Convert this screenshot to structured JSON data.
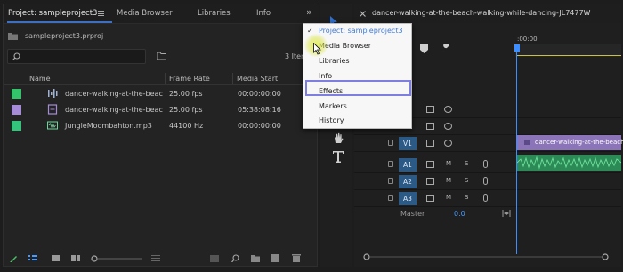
{
  "project_panel": {
    "tabs": [
      {
        "label": "Project: sampleproject3"
      },
      {
        "label": "Media Browser"
      },
      {
        "label": "Libraries"
      },
      {
        "label": "Info"
      }
    ],
    "more_tabs_glyph": "»",
    "folder_label": "sampleproject3.prproj",
    "search_placeholder": "",
    "items_count": "3 Item",
    "columns": {
      "name": "Name",
      "frame_rate": "Frame Rate",
      "media_start": "Media Start"
    },
    "rows": [
      {
        "name": "dancer-walking-at-the-beac",
        "frame_rate": "25.00 fps",
        "media_start": "00:00:00:00",
        "swatch_color": "#33c36a",
        "icon": "sequence-icon"
      },
      {
        "name": "dancer-walking-at-the-beac",
        "frame_rate": "25.00 fps",
        "media_start": "05:38:08:16",
        "swatch_color": "#a58bd8",
        "icon": "video-clip-icon"
      },
      {
        "name": "JungleMoombahton.mp3",
        "frame_rate": "44100 Hz",
        "media_start": "00:00:00:00",
        "swatch_color": "#33c37a",
        "icon": "audio-clip-icon"
      }
    ]
  },
  "timeline": {
    "sequence_title": "dancer-walking-at-the-beach-walking-while-dancing-JL7477W",
    "timecode_fragment": "00",
    "ruler_time": ":00:00",
    "tracks": [
      {
        "label": "V1"
      },
      {
        "label": "A1",
        "mute": "M",
        "solo": "S"
      },
      {
        "label": "A2",
        "mute": "M",
        "solo": "S"
      },
      {
        "label": "A3",
        "mute": "M",
        "solo": "S"
      }
    ],
    "video_clip_label": "dancer-walking-at-the-beach-w",
    "master_label": "Master",
    "master_value": "0.0"
  },
  "window_menu": {
    "items": [
      {
        "label": "Project: sampleproject3",
        "checked": true
      },
      {
        "label": "Media Browser"
      },
      {
        "label": "Libraries"
      },
      {
        "label": "Info"
      },
      {
        "label": "Effects",
        "highlighted": true
      },
      {
        "label": "Markers"
      },
      {
        "label": "History"
      }
    ],
    "check_glyph": "✓"
  },
  "colors": {
    "accent_blue": "#4a9bff",
    "track_label_bg": "#2b5a87",
    "video_clip": "#8b74b8",
    "audio_clip": "#2b8a55",
    "menu_highlight_border": "#7d7ee0"
  }
}
